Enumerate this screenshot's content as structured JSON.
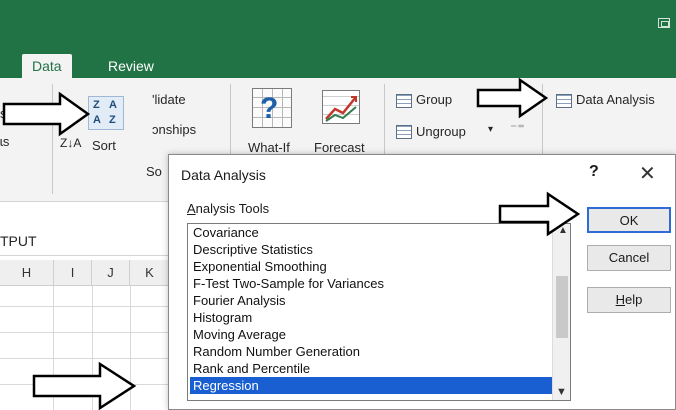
{
  "ribbon_tabs": [
    "Data",
    "Review"
  ],
  "ribbon": {
    "sort_label": "Sort",
    "sort_za_icon": "sort-za-icon",
    "sort_az_small": "Z↓A",
    "validate_partial": "'lidate",
    "relationships_partial": "ɔnships",
    "left_cut_a": "s",
    "left_cut_b": "ɩs",
    "left_cut_c": ";",
    "whatif_label": "What-If",
    "forecast_label": "Forecast",
    "sort_group_partial": "So",
    "group_label": "Group",
    "ungroup_label": "Ungroup",
    "data_analysis_label": "Data Analysis"
  },
  "namebox": {
    "text": "TPUT"
  },
  "columns": [
    "H",
    "I",
    "J",
    "K"
  ],
  "dialog": {
    "title": "Data Analysis",
    "help_symbol": "?",
    "close_symbol": "✕",
    "tools_label_prefix": "A",
    "tools_label_rest": "nalysis Tools",
    "items": [
      "Covariance",
      "Descriptive Statistics",
      "Exponential Smoothing",
      "F-Test Two-Sample for Variances",
      "Fourier Analysis",
      "Histogram",
      "Moving Average",
      "Random Number Generation",
      "Rank and Percentile",
      "Regression"
    ],
    "selected_item": "Regression",
    "ok_label": "OK",
    "cancel_label": "Cancel",
    "help_label_prefix": "H",
    "help_label_rest": "elp"
  },
  "colors": {
    "excel_green": "#217346",
    "selection_blue": "#1a5fd1",
    "ok_border": "#2e6bd6"
  }
}
